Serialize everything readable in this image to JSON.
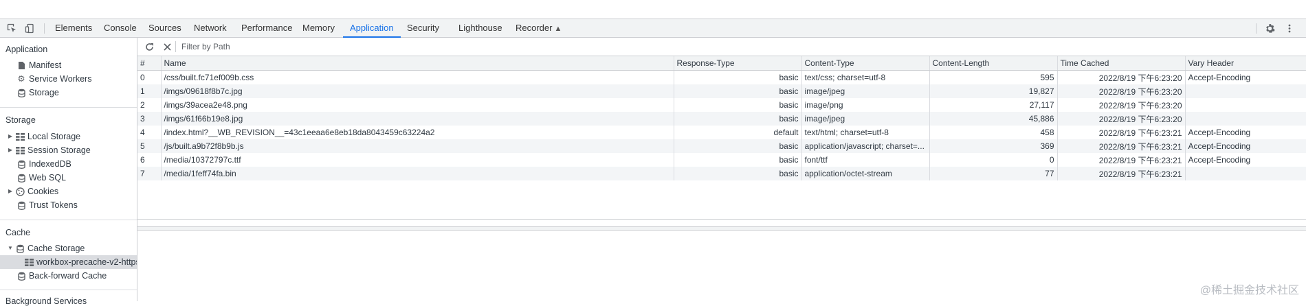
{
  "toolbar": {
    "tabs": [
      {
        "label": "Elements",
        "active": false
      },
      {
        "label": "Console",
        "active": false
      },
      {
        "label": "Sources",
        "active": false
      },
      {
        "label": "Network",
        "active": false
      },
      {
        "label": "Performance",
        "active": false
      },
      {
        "label": "Memory",
        "active": false
      },
      {
        "label": "Application",
        "active": true
      },
      {
        "label": "Security",
        "active": false
      },
      {
        "label": "Lighthouse",
        "active": false
      },
      {
        "label": "Recorder",
        "active": false
      }
    ]
  },
  "sidebar": {
    "application": {
      "title": "Application",
      "items": [
        {
          "label": "Manifest",
          "icon": "document-icon"
        },
        {
          "label": "Service Workers",
          "icon": "gear-icon"
        },
        {
          "label": "Storage",
          "icon": "database-icon"
        }
      ]
    },
    "storage": {
      "title": "Storage",
      "items": [
        {
          "label": "Local Storage",
          "icon": "grid-icon",
          "expandable": true
        },
        {
          "label": "Session Storage",
          "icon": "grid-icon",
          "expandable": true
        },
        {
          "label": "IndexedDB",
          "icon": "database-icon"
        },
        {
          "label": "Web SQL",
          "icon": "database-icon"
        },
        {
          "label": "Cookies",
          "icon": "cookie-icon",
          "expandable": true
        },
        {
          "label": "Trust Tokens",
          "icon": "database-icon"
        }
      ]
    },
    "cache": {
      "title": "Cache",
      "items": [
        {
          "label": "Cache Storage",
          "icon": "database-icon",
          "expanded": true
        },
        {
          "label": "workbox-precache-v2-https:",
          "icon": "grid-icon",
          "selected": true
        },
        {
          "label": "Back-forward Cache",
          "icon": "database-icon"
        }
      ]
    },
    "next_section_title": "Background Services"
  },
  "filter": {
    "placeholder": "Filter by Path",
    "value": ""
  },
  "table": {
    "columns": [
      "#",
      "Name",
      "Response-Type",
      "Content-Type",
      "Content-Length",
      "Time Cached",
      "Vary Header"
    ],
    "rows": [
      [
        "0",
        "/css/built.fc71ef009b.css",
        "basic",
        "text/css; charset=utf-8",
        "595",
        "2022/8/19 下午6:23:20",
        "Accept-Encoding"
      ],
      [
        "1",
        "/imgs/09618f8b7c.jpg",
        "basic",
        "image/jpeg",
        "19,827",
        "2022/8/19 下午6:23:20",
        ""
      ],
      [
        "2",
        "/imgs/39acea2e48.png",
        "basic",
        "image/png",
        "27,117",
        "2022/8/19 下午6:23:20",
        ""
      ],
      [
        "3",
        "/imgs/61f66b19e8.jpg",
        "basic",
        "image/jpeg",
        "45,886",
        "2022/8/19 下午6:23:20",
        ""
      ],
      [
        "4",
        "/index.html?__WB_REVISION__=43c1eeaa6e8eb18da8043459c63224a2",
        "default",
        "text/html; charset=utf-8",
        "458",
        "2022/8/19 下午6:23:21",
        "Accept-Encoding"
      ],
      [
        "5",
        "/js/built.a9b72f8b9b.js",
        "basic",
        "application/javascript; charset=...",
        "369",
        "2022/8/19 下午6:23:21",
        "Accept-Encoding"
      ],
      [
        "6",
        "/media/10372797c.ttf",
        "basic",
        "font/ttf",
        "0",
        "2022/8/19 下午6:23:21",
        "Accept-Encoding"
      ],
      [
        "7",
        "/media/1feff74fa.bin",
        "basic",
        "application/octet-stream",
        "77",
        "2022/8/19 下午6:23:21",
        ""
      ]
    ]
  },
  "watermark": "@稀土掘金技术社区",
  "colors": {
    "accent": "#1a73e8",
    "toolbar_bg": "#f1f3f4",
    "row_alt": "#f3f5f7",
    "border": "#cbcdd1",
    "selected_item": "#dadce0"
  }
}
